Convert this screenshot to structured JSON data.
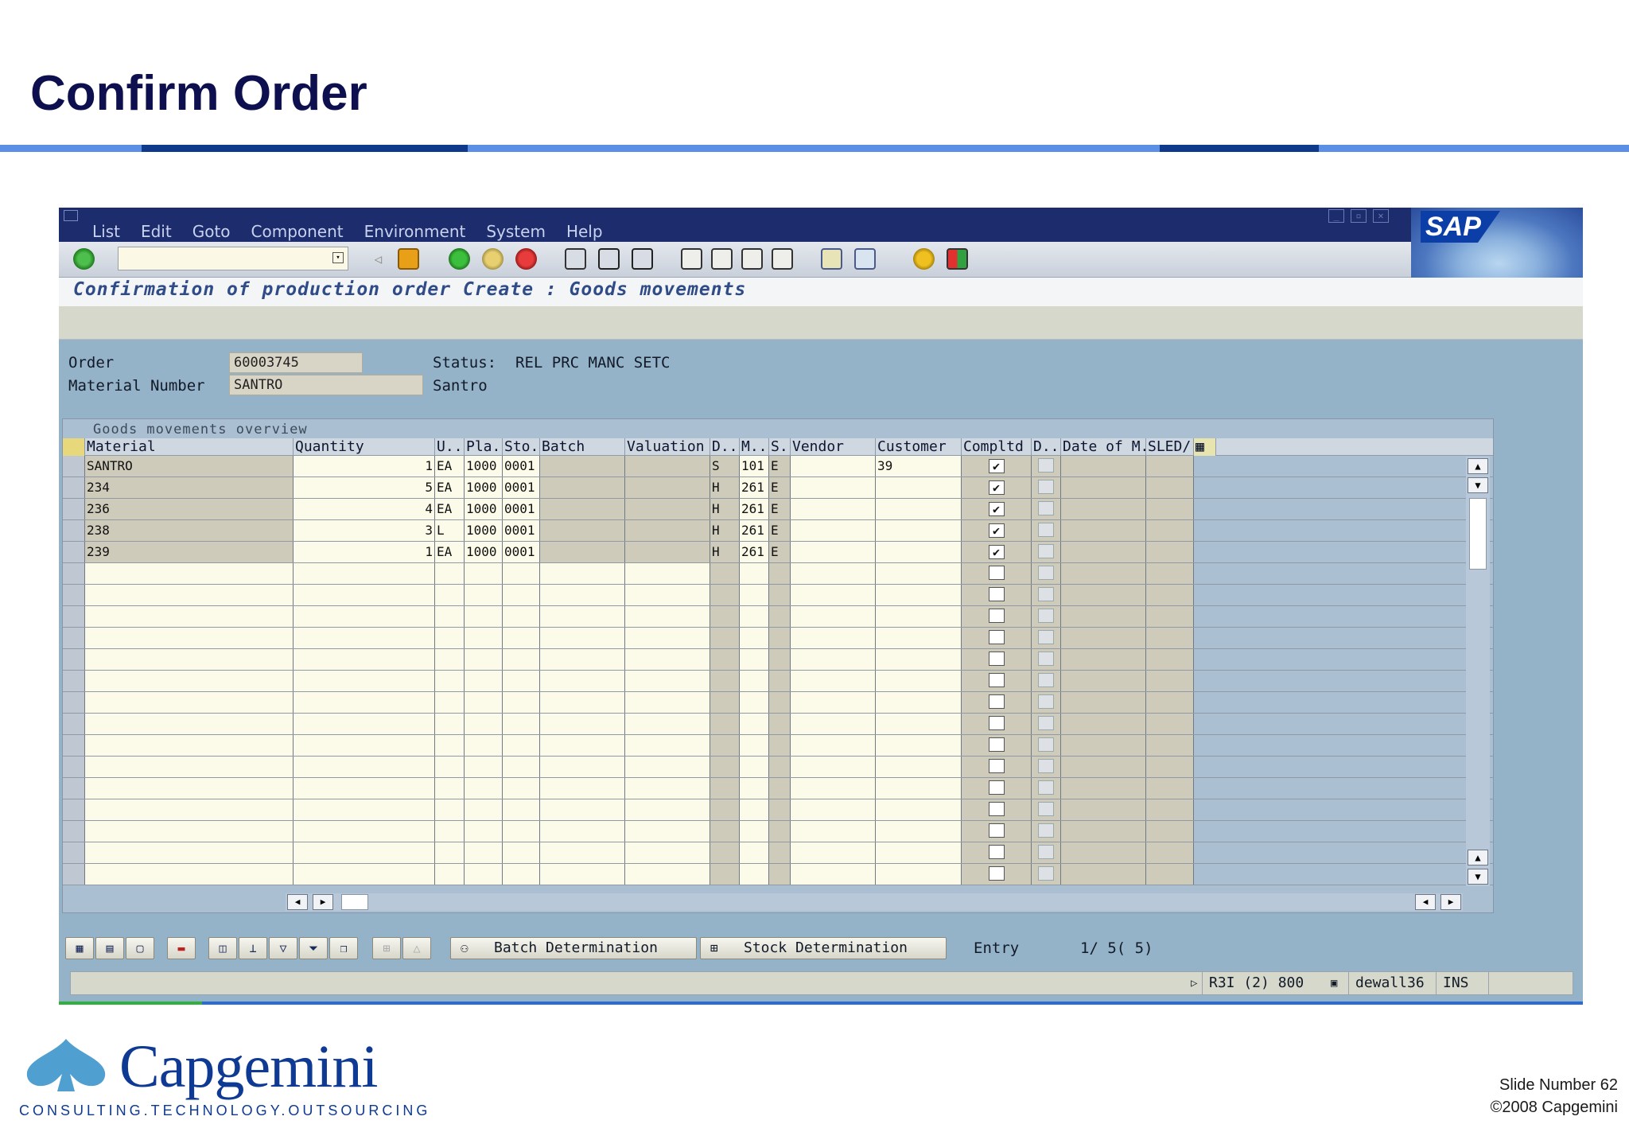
{
  "slide": {
    "title": "Confirm Order",
    "slide_number": "Slide Number 62",
    "copyright": "©2008 Capgemini",
    "company": "Capgemini",
    "tagline": "CONSULTING.TECHNOLOGY.OUTSOURCING"
  },
  "sap": {
    "menu": [
      "List",
      "Edit",
      "Goto",
      "Component",
      "Environment",
      "System",
      "Help"
    ],
    "logo": "SAP",
    "command_field": {
      "value": "",
      "placeholder": ""
    },
    "screen_title": "Confirmation of production order Create : Goods movements",
    "header": {
      "order_label": "Order",
      "order_value": "60003745",
      "status_label": "Status:",
      "status_value": "REL  PRC  MANC SETC",
      "material_label": "Material Number",
      "material_value": "SANTRO",
      "material_desc": "Santro"
    },
    "table": {
      "group_title": "Goods movements overview",
      "columns": [
        "Material",
        "Quantity",
        "U...",
        "Pla...",
        "Sto...",
        "Batch",
        "Valuation ...",
        "D...",
        "M...",
        "S...",
        "Vendor",
        "Customer",
        "Compltd",
        "D...",
        "Date of M...",
        "SLED/"
      ],
      "rows": [
        {
          "material": "SANTRO",
          "quantity": "1",
          "unit": "EA",
          "plant": "1000",
          "sloc": "0001",
          "batch": "",
          "valuation": "",
          "debit": "S",
          "mvt": "101",
          "special": "E",
          "vendor": "",
          "customer": "39",
          "completed": true
        },
        {
          "material": "234",
          "quantity": "5",
          "unit": "EA",
          "plant": "1000",
          "sloc": "0001",
          "batch": "",
          "valuation": "",
          "debit": "H",
          "mvt": "261",
          "special": "E",
          "vendor": "",
          "customer": "",
          "completed": true
        },
        {
          "material": "236",
          "quantity": "4",
          "unit": "EA",
          "plant": "1000",
          "sloc": "0001",
          "batch": "",
          "valuation": "",
          "debit": "H",
          "mvt": "261",
          "special": "E",
          "vendor": "",
          "customer": "",
          "completed": true
        },
        {
          "material": "238",
          "quantity": "3",
          "unit": "L",
          "plant": "1000",
          "sloc": "0001",
          "batch": "",
          "valuation": "",
          "debit": "H",
          "mvt": "261",
          "special": "E",
          "vendor": "",
          "customer": "",
          "completed": true
        },
        {
          "material": "239",
          "quantity": "1",
          "unit": "EA",
          "plant": "1000",
          "sloc": "0001",
          "batch": "",
          "valuation": "",
          "debit": "H",
          "mvt": "261",
          "special": "E",
          "vendor": "",
          "customer": "",
          "completed": true
        }
      ],
      "empty_rows": 15
    },
    "buttons": {
      "batch_determination": "Batch Determination",
      "stock_determination": "Stock Determination"
    },
    "entry": {
      "label": "Entry",
      "value": "1/ 5( 5)"
    },
    "status_bar": {
      "system": "R3I (2) 800",
      "user": "dewall36",
      "mode": "INS"
    }
  }
}
